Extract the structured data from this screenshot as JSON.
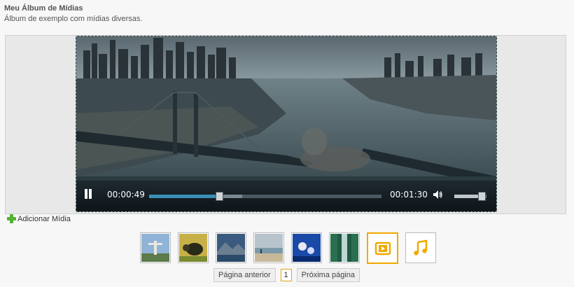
{
  "album": {
    "title": "Meu Álbum de Mídias",
    "description": "Álbum de exemplo com mídias diversas."
  },
  "player": {
    "current_time": "00:00:49",
    "duration": "00:01:30",
    "progress": 0.3,
    "buffered": 0.4,
    "volume": 0.85,
    "accent_color": "#3a8fb7"
  },
  "actions": {
    "add_media_label": "Adicionar Mídia"
  },
  "thumbnails": [
    {
      "name": "thumb-christ-redeemer",
      "icon": "photo"
    },
    {
      "name": "thumb-turtle",
      "icon": "photo"
    },
    {
      "name": "thumb-mountain-lake",
      "icon": "photo"
    },
    {
      "name": "thumb-beach",
      "icon": "photo"
    },
    {
      "name": "thumb-underwater",
      "icon": "photo"
    },
    {
      "name": "thumb-waterfall",
      "icon": "photo"
    },
    {
      "name": "thumb-video",
      "icon": "video-icon",
      "selected": true
    },
    {
      "name": "thumb-audio",
      "icon": "music-icon"
    }
  ],
  "pagination": {
    "prev_label": "Página anterior",
    "current_page": "1",
    "next_label": "Próxima página"
  },
  "colors": {
    "selected_border": "#f0a800",
    "add_icon": "#55b035",
    "media_icon": "#f0a800"
  }
}
